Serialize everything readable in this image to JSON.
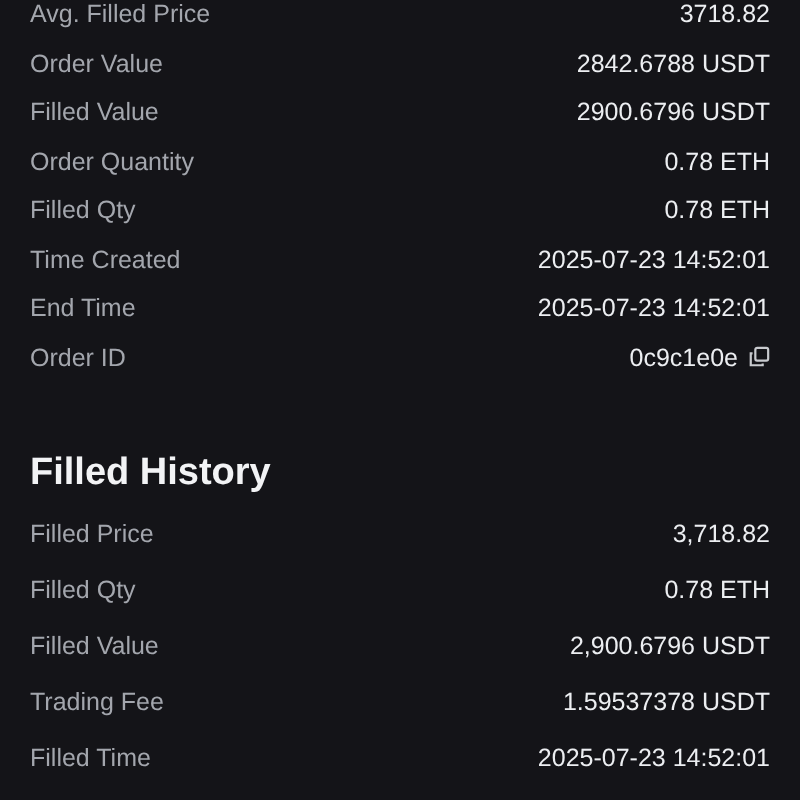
{
  "order_details": [
    {
      "label": "Avg. Filled Price",
      "value": "3718.82",
      "copyable": false
    },
    {
      "label": "Order Value",
      "value": "2842.6788 USDT",
      "copyable": false
    },
    {
      "label": "Filled Value",
      "value": "2900.6796 USDT",
      "copyable": false
    },
    {
      "label": "Order Quantity",
      "value": "0.78 ETH",
      "copyable": false
    },
    {
      "label": "Filled Qty",
      "value": "0.78 ETH",
      "copyable": false
    },
    {
      "label": "Time Created",
      "value": "2025-07-23 14:52:01",
      "copyable": false
    },
    {
      "label": "End Time",
      "value": "2025-07-23 14:52:01",
      "copyable": false
    },
    {
      "label": "Order ID",
      "value": "0c9c1e0e",
      "copyable": true
    }
  ],
  "filled_history": {
    "title": "Filled History",
    "rows": [
      {
        "label": "Filled Price",
        "value": "3,718.82"
      },
      {
        "label": "Filled Qty",
        "value": "0.78 ETH"
      },
      {
        "label": "Filled Value",
        "value": "2,900.6796 USDT"
      },
      {
        "label": "Trading Fee",
        "value": "1.59537378 USDT"
      },
      {
        "label": "Filled Time",
        "value": "2025-07-23 14:52:01"
      }
    ]
  }
}
